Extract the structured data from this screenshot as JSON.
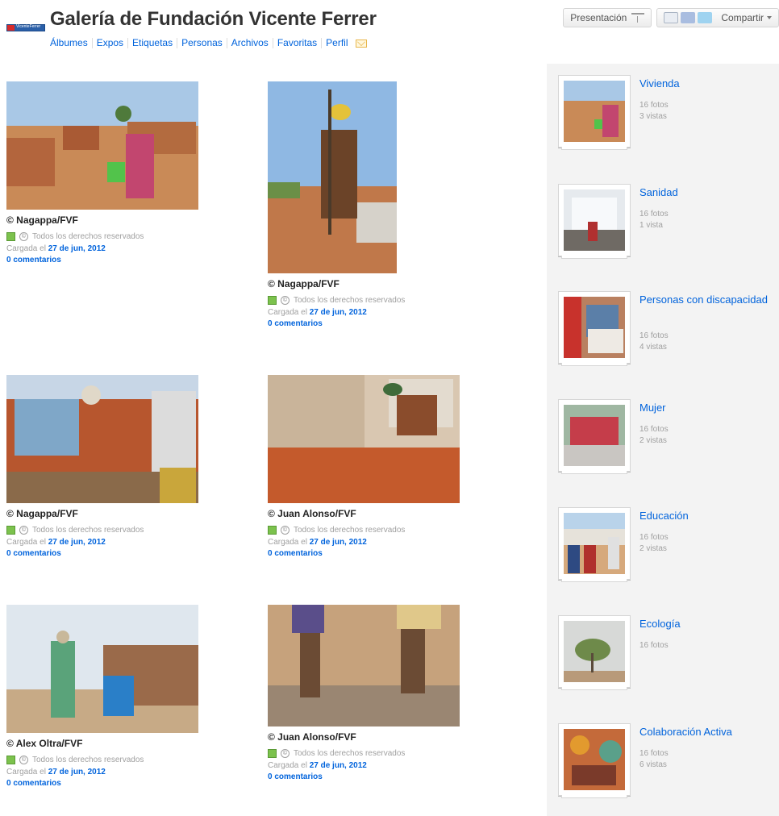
{
  "header": {
    "logo_text": "VicenteFerrer",
    "title": "Galería de Fundación Vicente Ferrer",
    "nav": [
      "Álbumes",
      "Expos",
      "Etiquetas",
      "Personas",
      "Archivos",
      "Favoritas",
      "Perfil"
    ]
  },
  "toolbar": {
    "presentation_label": "Presentación",
    "share_label": "Compartir"
  },
  "photos": [
    {
      "caption": "© Nagappa/FVF",
      "license": "Todos los derechos reservados",
      "uploaded_prefix": "Cargada el",
      "date": "27 de jun, 2012",
      "comments": "0 comentarios"
    },
    {
      "caption": "© Nagappa/FVF",
      "license": "Todos los derechos reservados",
      "uploaded_prefix": "Cargada el",
      "date": "27 de jun, 2012",
      "comments": "0 comentarios"
    },
    {
      "caption": "© Nagappa/FVF",
      "license": "Todos los derechos reservados",
      "uploaded_prefix": "Cargada el",
      "date": "27 de jun, 2012",
      "comments": "0 comentarios"
    },
    {
      "caption": "© Juan Alonso/FVF",
      "license": "Todos los derechos reservados",
      "uploaded_prefix": "Cargada el",
      "date": "27 de jun, 2012",
      "comments": "0 comentarios"
    },
    {
      "caption": "© Alex Oltra/FVF",
      "license": "Todos los derechos reservados",
      "uploaded_prefix": "Cargada el",
      "date": "27 de jun, 2012",
      "comments": "0 comentarios"
    },
    {
      "caption": "© Juan Alonso/FVF",
      "license": "Todos los derechos reservados",
      "uploaded_prefix": "Cargada el",
      "date": "27 de jun, 2012",
      "comments": "0 comentarios"
    }
  ],
  "sets": [
    {
      "name": "Vivienda",
      "photos": "16 fotos",
      "views": "3 vistas"
    },
    {
      "name": "Sanidad",
      "photos": "16 fotos",
      "views": "1 vista"
    },
    {
      "name": "Personas con discapacidad",
      "photos": "16 fotos",
      "views": "4 vistas"
    },
    {
      "name": "Mujer",
      "photos": "16 fotos",
      "views": "2 vistas"
    },
    {
      "name": "Educación",
      "photos": "16 fotos",
      "views": "2 vistas"
    },
    {
      "name": "Ecología",
      "photos": "16 fotos",
      "views": ""
    },
    {
      "name": "Colaboración Activa",
      "photos": "16 fotos",
      "views": "6 vistas"
    }
  ]
}
